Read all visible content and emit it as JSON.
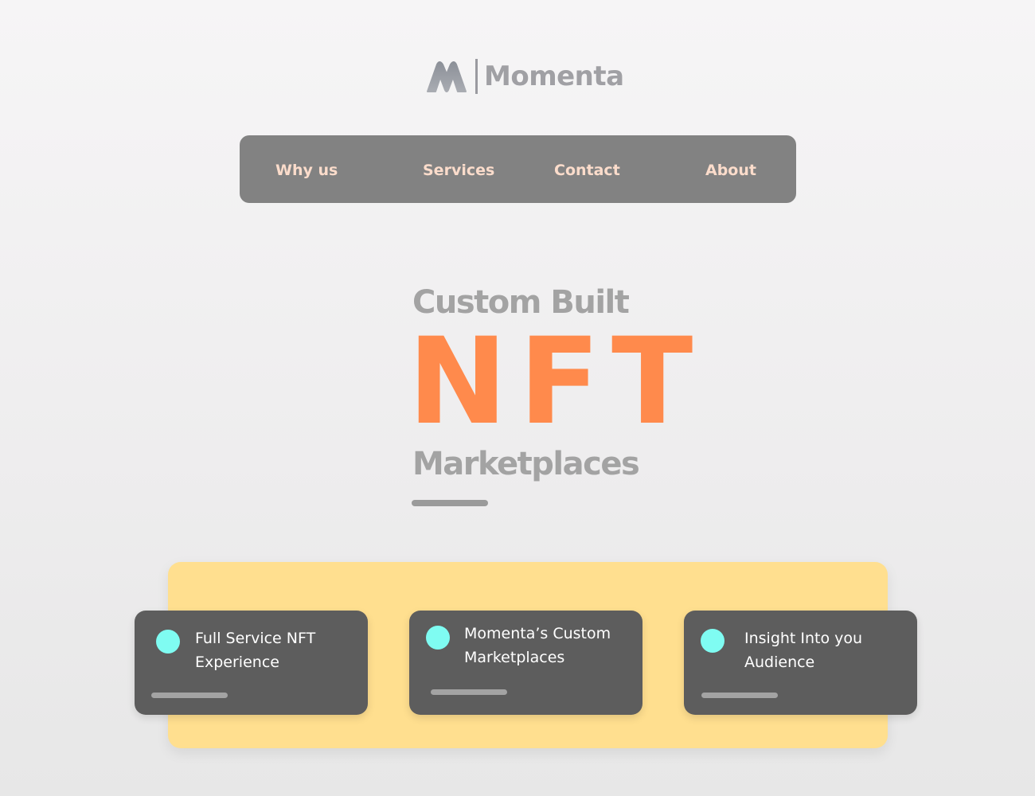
{
  "brand": {
    "name": "Momenta",
    "logo_icon": "momenta-m-logo-icon",
    "logo_color": "#8f939b"
  },
  "nav": {
    "items": [
      {
        "label": "Why us"
      },
      {
        "label": "Services"
      },
      {
        "label": "Contact"
      },
      {
        "label": "About"
      }
    ],
    "background": "#828282",
    "text_color": "#fbdccb"
  },
  "hero": {
    "line1": "Custom Built",
    "highlight": "NFT",
    "line3": "Marketplaces",
    "highlight_color": "#ff8a4c",
    "text_color": "#a3a3a3"
  },
  "features": {
    "panel_color": "#ffdf8f",
    "card_color": "#5d5d5d",
    "dot_color": "#7ffcf2",
    "cards": [
      {
        "line1": "Full Service NFT",
        "line2": "Experience"
      },
      {
        "line1": "Momenta’s Custom",
        "line2": "Marketplaces"
      },
      {
        "line1": "Insight Into you",
        "line2": "Audience"
      }
    ]
  }
}
